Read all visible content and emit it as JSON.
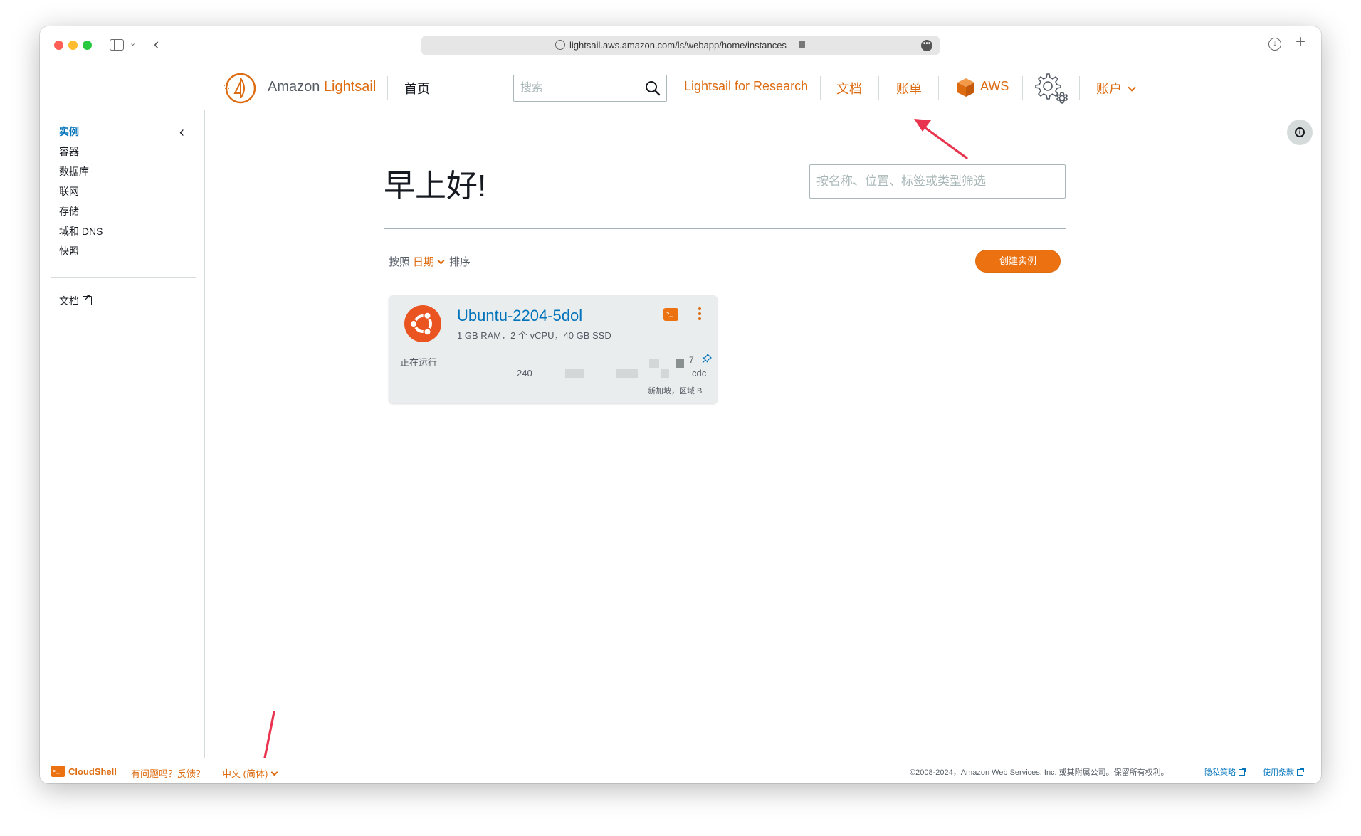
{
  "browser": {
    "url": "lightsail.aws.amazon.com/ls/webapp/home/instances"
  },
  "header": {
    "logo_prefix": "Amazon ",
    "logo_accent": "Lightsail",
    "home": "首页",
    "search_placeholder": "搜索",
    "research": "Lightsail for Research",
    "docs": "文档",
    "billing": "账单",
    "aws": "AWS",
    "account": "账户"
  },
  "sidebar": {
    "items": [
      {
        "label": "实例"
      },
      {
        "label": "容器"
      },
      {
        "label": "数据库"
      },
      {
        "label": "联网"
      },
      {
        "label": "存储"
      },
      {
        "label": "域和 DNS"
      },
      {
        "label": "快照"
      }
    ],
    "docs": "文档"
  },
  "main": {
    "greeting": "早上好!",
    "filter_placeholder": "按名称、位置、标签或类型筛选",
    "sort_prefix": "按照",
    "sort_value": "日期",
    "sort_suffix": "排序",
    "create_button": "创建实例"
  },
  "instance": {
    "name": "Ubuntu-2204-5dol",
    "spec": "1 GB RAM，2 个 vCPU，40 GB SSD",
    "status": "正在运行",
    "ip_prefix": "240",
    "ip_suffix": "7",
    "zone": "cdc",
    "region": "新加坡，区域 B"
  },
  "footer": {
    "cloudshell": "CloudShell",
    "feedback": "有问题吗？反馈？",
    "language": "中文 (简体)",
    "copyright": "©2008-2024，Amazon Web Services, Inc. 或其附属公司。保留所有权利。",
    "privacy": "隐私策略",
    "terms": "使用条款"
  },
  "colors": {
    "accent": "#dd6b10",
    "button": "#ec7211",
    "link_blue": "#0073bb",
    "annotation": "#e8344e"
  }
}
